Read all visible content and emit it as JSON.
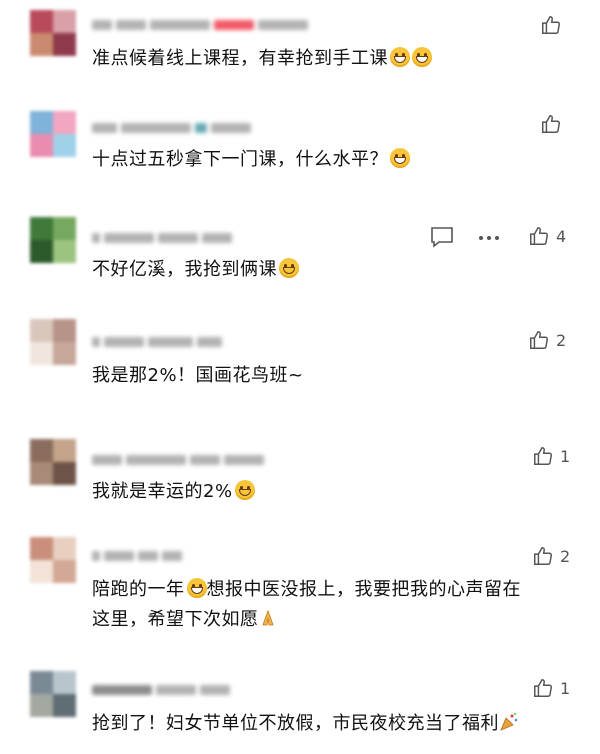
{
  "comments": [
    {
      "text": "准点候着线上课程，有幸抢到手工课",
      "like_count": "",
      "emoji": [
        "grin-icon",
        "grin-icon"
      ]
    },
    {
      "text": "十点过五秒拿下一门课，什么水平？",
      "like_count": "",
      "emoji": [
        "squint-icon"
      ]
    },
    {
      "text": "不好亿溪，我抢到俩课",
      "like_count": "4",
      "emoji": [
        "smile-icon"
      ]
    },
    {
      "text": "我是那2%！国画花鸟班~",
      "like_count": "2",
      "emoji": []
    },
    {
      "text": "我就是幸运的2%",
      "like_count": "1",
      "emoji": [
        "hug-icon"
      ]
    },
    {
      "text_line1_a": "陪跑的一年",
      "text_line1_b": "想报中医没报上，我要把我的心声留在",
      "text_line2": "这里，希望下次如愿",
      "like_count": "2",
      "emoji": [
        "sweat-icon",
        "pray-icon"
      ]
    },
    {
      "text": "抢到了！妇女节单位不放假，市民夜校充当了福利",
      "like_count": "1",
      "emoji": [
        "party-icon"
      ]
    }
  ],
  "colors": {
    "icon": "#555555",
    "text": "#111111"
  }
}
